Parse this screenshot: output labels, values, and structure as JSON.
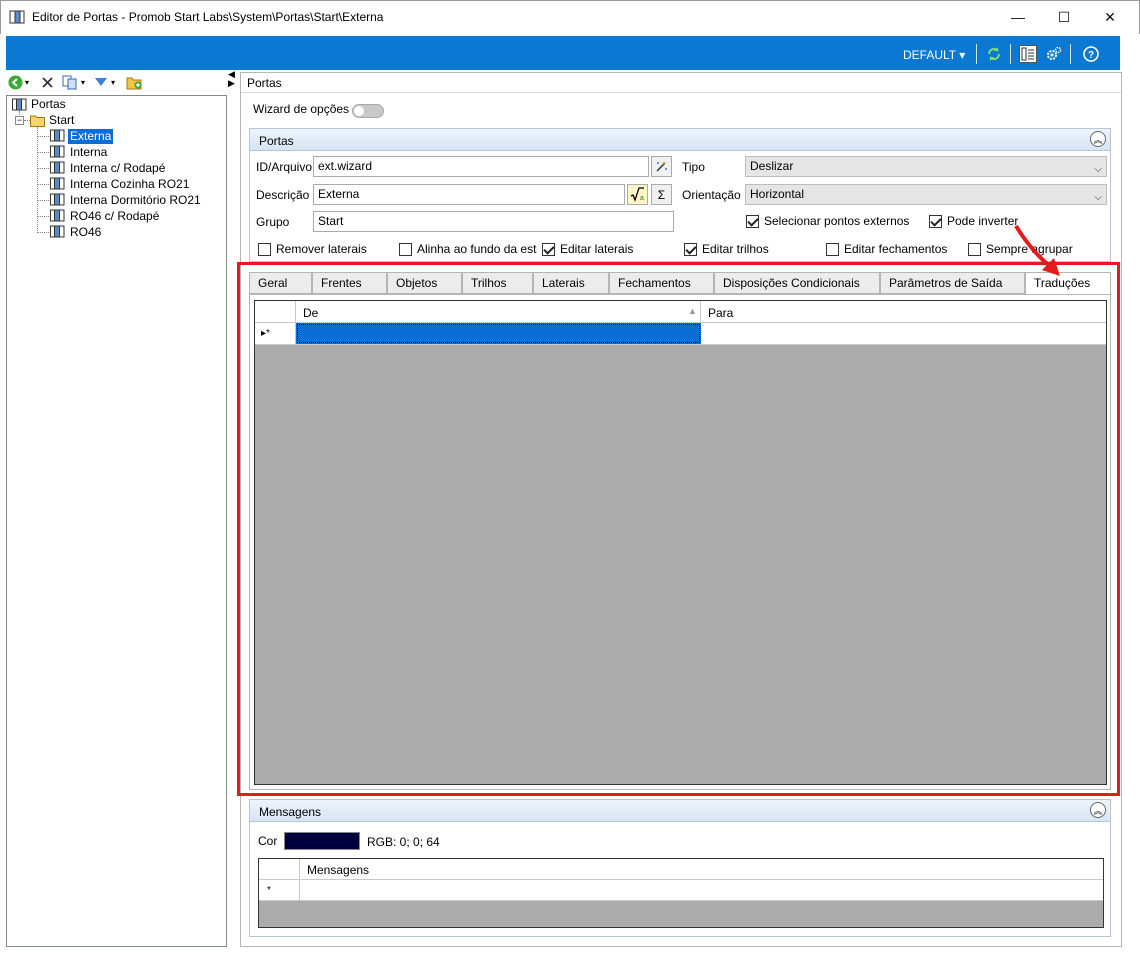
{
  "window": {
    "title": "Editor de Portas - Promob Start Labs\\System\\Portas\\Start\\Externa",
    "minimize": "—",
    "maximize": "☐",
    "close": "✕"
  },
  "toolbar": {
    "profile": "DEFAULT",
    "profile_arrow": "▾",
    "icons": [
      "refresh-icon",
      "list-view-icon",
      "settings-icon",
      "help-icon"
    ]
  },
  "tree": {
    "root": "Portas",
    "folder": "Start",
    "items": [
      "Externa",
      "Interna",
      "Interna c/ Rodapé",
      "Interna Cozinha RO21",
      "Interna Dormitório RO21",
      "RO46 c/ Rodapé",
      "RO46"
    ],
    "selected_index": 0
  },
  "main": {
    "header": "Portas",
    "wizard_label": "Wizard de opções",
    "wizard_on": false
  },
  "portas_group": {
    "title": "Portas",
    "id_label": "ID/Arquivo",
    "id_value": "ext.wizard",
    "desc_label": "Descrição",
    "desc_value": "Externa",
    "grupo_label": "Grupo",
    "grupo_value": "Start",
    "tipo_label": "Tipo",
    "tipo_value": "Deslizar",
    "orient_label": "Orientação",
    "orient_value": "Horizontal",
    "sigma": "Σ",
    "checkboxes": [
      {
        "label": "Selecionar pontos externos",
        "checked": true
      },
      {
        "label": "Pode inverter",
        "checked": true
      },
      {
        "label": "Remover laterais",
        "checked": false
      },
      {
        "label": "Alinha ao fundo da est",
        "checked": false
      },
      {
        "label": "Editar laterais",
        "checked": true
      },
      {
        "label": "Editar trilhos",
        "checked": true
      },
      {
        "label": "Editar fechamentos",
        "checked": false
      },
      {
        "label": "Sempre agrupar",
        "checked": false
      }
    ]
  },
  "tabs": [
    "Geral",
    "Frentes",
    "Objetos",
    "Trilhos",
    "Laterais",
    "Fechamentos",
    "Disposições Condicionais",
    "Parâmetros de Saída",
    "Traduções"
  ],
  "active_tab": 8,
  "translations_grid": {
    "columns": [
      "De",
      "Para"
    ],
    "new_row_marker": "▸*"
  },
  "mensagens": {
    "title": "Mensagens",
    "cor_label": "Cor",
    "color": "#000040",
    "rgb_text": "RGB: 0; 0; 64",
    "column": "Mensagens",
    "new_row_marker": "*"
  },
  "colors": {
    "accent": "#0b78d1",
    "selection": "#0a6ed6",
    "highlight_box": "#e31b1b"
  }
}
